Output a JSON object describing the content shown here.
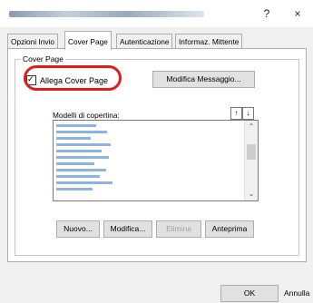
{
  "titlebar": {
    "help": "?",
    "close": "×"
  },
  "tabs": [
    "Opzioni Invio",
    "Cover Page",
    "Autenticazione",
    "Informaz. Mittente"
  ],
  "group": {
    "legend": "Cover Page"
  },
  "checkbox": {
    "label": "Allega Cover Page",
    "checked": true
  },
  "buttons": {
    "edit_message": "Modifica Messaggio...",
    "new": "Nuovo...",
    "modify": "Modifica...",
    "delete": "Elimina",
    "preview": "Anteprima",
    "ok": "OK",
    "cancel": "Annulla"
  },
  "list": {
    "label": "Modelli di copertina:",
    "sort_up": "↑",
    "sort_down": "↓"
  },
  "colors": {
    "highlight": "#e21b1b"
  }
}
